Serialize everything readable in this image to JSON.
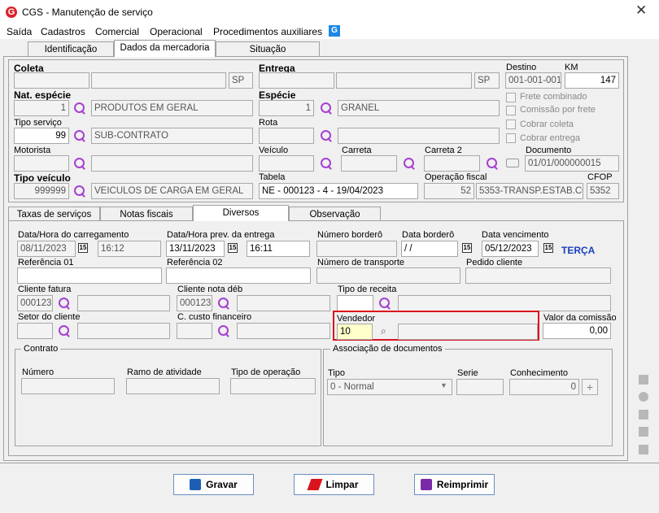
{
  "window": {
    "logo": "G",
    "title": "CGS - Manutenção de serviço",
    "close": "✕"
  },
  "menu": [
    "Saída",
    "Cadastros",
    "Comercial",
    "Operacional",
    "Procedimentos auxiliares"
  ],
  "menu_icon": "G",
  "tabs_top": [
    "Identificação",
    "Dados da mercadoria",
    "Situação"
  ],
  "coleta": {
    "label": "Coleta",
    "code": "",
    "name": "",
    "uf": "SP"
  },
  "entrega": {
    "label": "Entrega",
    "code": "",
    "name": "",
    "uf": "SP"
  },
  "destino": {
    "label": "Destino",
    "value": "001-001-001"
  },
  "km": {
    "label": "KM",
    "value": "147"
  },
  "nat_especie": {
    "label": "Nat. espécie",
    "code": "1",
    "name": "PRODUTOS EM GERAL"
  },
  "especie": {
    "label": "Espécie",
    "code": "1",
    "name": "GRANEL"
  },
  "checks": [
    "Frete combinado",
    "Comissão por frete",
    "Cobrar coleta",
    "Cobrar entrega"
  ],
  "tipo_servico": {
    "label": "Tipo serviço",
    "code": "99",
    "name": "SUB-CONTRATO"
  },
  "rota": {
    "label": "Rota"
  },
  "motorista": {
    "label": "Motorista"
  },
  "veiculo": {
    "label": "Veículo"
  },
  "carreta": {
    "label": "Carreta"
  },
  "carreta2": {
    "label": "Carreta 2"
  },
  "documento": {
    "label": "Documento",
    "value": "01/01/000000015"
  },
  "tipo_veiculo": {
    "label": "Tipo veículo",
    "code": "999999",
    "name": "VEICULOS DE CARGA EM GERAL"
  },
  "tabela": {
    "label": "Tabela",
    "value": "NE - 000123 - 4 - 19/04/2023"
  },
  "op_fiscal": {
    "label": "Operação fiscal",
    "code": "52",
    "name": "5353-TRANSP.ESTAB.CO"
  },
  "cfop": {
    "label": "CFOP",
    "value": "5352"
  },
  "tabs_bottom": [
    "Taxas de serviços",
    "Notas fiscais",
    "Diversos",
    "Observação"
  ],
  "data_carregamento": {
    "label": "Data/Hora do carregamento",
    "date": "08/11/2023",
    "time": "16:12"
  },
  "data_prev": {
    "label": "Data/Hora prev. da entrega",
    "date": "13/11/2023",
    "time": "16:11"
  },
  "num_bordero": {
    "label": "Número borderô"
  },
  "data_bordero": {
    "label": "Data borderô",
    "value": " / /"
  },
  "data_venc": {
    "label": "Data vencimento",
    "value": "05/12/2023",
    "weekday": "TERÇA"
  },
  "cal_text": "15",
  "ref01": {
    "label": "Referência 01"
  },
  "ref02": {
    "label": "Referência 02"
  },
  "num_transporte": {
    "label": "Número de transporte"
  },
  "pedido_cliente": {
    "label": "Pedido cliente"
  },
  "cliente_fatura": {
    "label": "Cliente fatura",
    "code": "000123",
    "name": ""
  },
  "cliente_nota": {
    "label": "Cliente nota déb",
    "code": "000123",
    "name": ""
  },
  "tipo_receita": {
    "label": "Tipo de receita"
  },
  "setor_cliente": {
    "label": "Setor do cliente"
  },
  "custo_fin": {
    "label": "C. custo financeiro"
  },
  "vendedor": {
    "label": "Vendedor",
    "code": "10",
    "name": ""
  },
  "valor_comissao": {
    "label": "Valor da comissão",
    "value": "0,00"
  },
  "contrato": {
    "title": "Contrato",
    "numero": "Número",
    "ramo": "Ramo de atividade",
    "tipo_op": "Tipo de operação"
  },
  "assoc": {
    "title": "Associação de documentos",
    "tipo": "Tipo",
    "tipo_value": "0 - Normal",
    "serie": "Serie",
    "conhecimento": "Conhecimento",
    "conh_value": "0",
    "plus": "+"
  },
  "buttons": {
    "gravar": "Gravar",
    "limpar": "Limpar",
    "reimprimir": "Reimprimir"
  },
  "colors": {
    "highlight": "#d9141c",
    "weekday": "#1a3fbf",
    "accent": "#a640d0"
  }
}
